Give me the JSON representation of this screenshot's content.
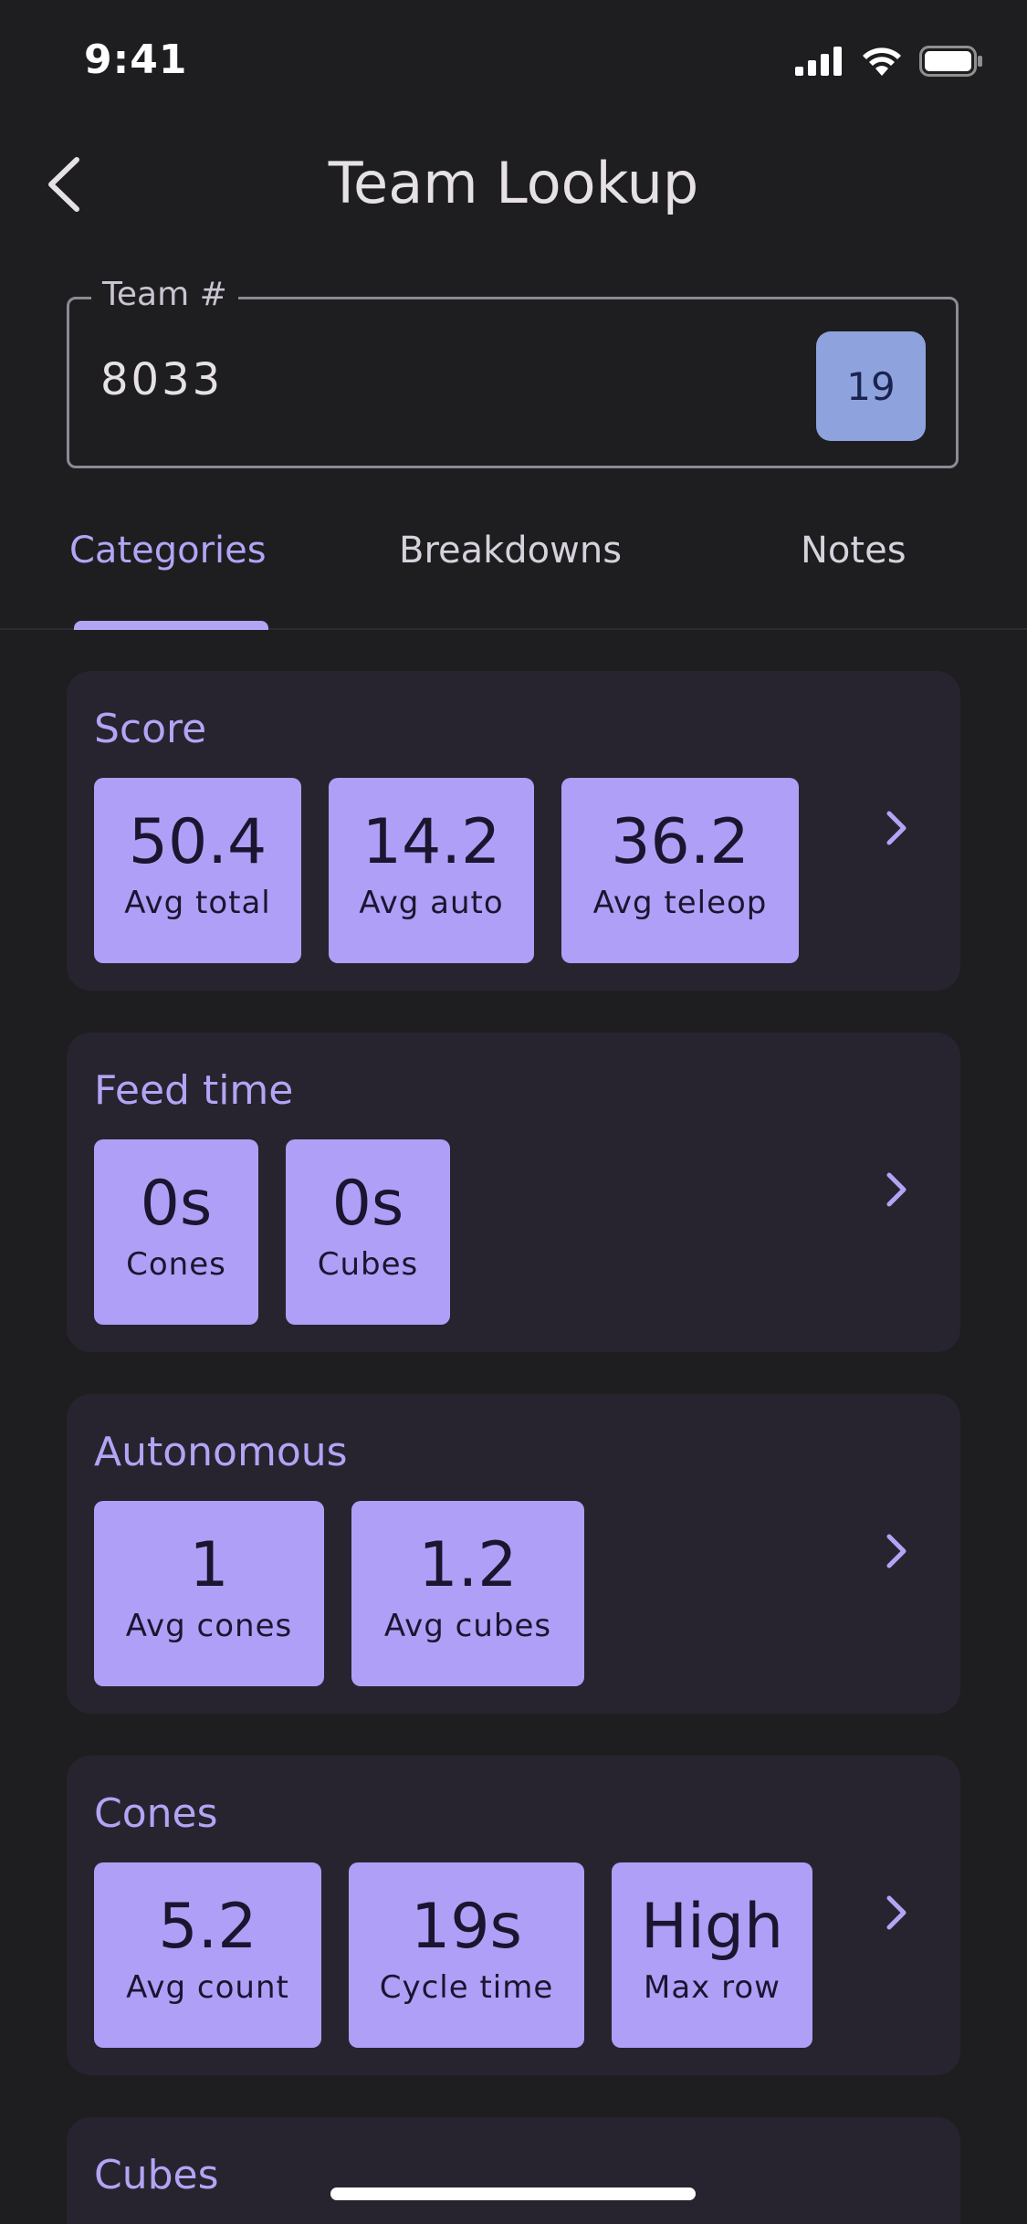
{
  "status_bar": {
    "time": "9:41"
  },
  "header": {
    "title": "Team Lookup"
  },
  "team_field": {
    "label": "Team #",
    "value": "8033",
    "badge": "19"
  },
  "tabs": [
    {
      "label": "Categories",
      "selected": true
    },
    {
      "label": "Breakdowns",
      "selected": false
    },
    {
      "label": "Notes",
      "selected": false
    }
  ],
  "cards": [
    {
      "title": "Score",
      "stats": [
        {
          "value": "50.4",
          "label": "Avg total"
        },
        {
          "value": "14.2",
          "label": "Avg auto"
        },
        {
          "value": "36.2",
          "label": "Avg teleop"
        }
      ]
    },
    {
      "title": "Feed time",
      "stats": [
        {
          "value": "0s",
          "label": "Cones"
        },
        {
          "value": "0s",
          "label": "Cubes"
        }
      ]
    },
    {
      "title": "Autonomous",
      "stats": [
        {
          "value": "1",
          "label": "Avg cones"
        },
        {
          "value": "1.2",
          "label": "Avg cubes"
        }
      ]
    },
    {
      "title": "Cones",
      "stats": [
        {
          "value": "5.2",
          "label": "Avg count"
        },
        {
          "value": "19s",
          "label": "Cycle time"
        },
        {
          "value": "High",
          "label": "Max row"
        }
      ]
    },
    {
      "title": "Cubes",
      "stats": []
    }
  ],
  "colors": {
    "background": "#1e1e20",
    "card": "#27242f",
    "accent": "#b3a4f5",
    "stat_box": "#b09ff6",
    "badge": "#8ea3dd"
  },
  "icons": {
    "back": "chevron-left-icon",
    "card_chevron": "chevron-right-icon",
    "signal": "cellular-signal-icon",
    "wifi": "wifi-icon",
    "battery": "battery-icon"
  }
}
